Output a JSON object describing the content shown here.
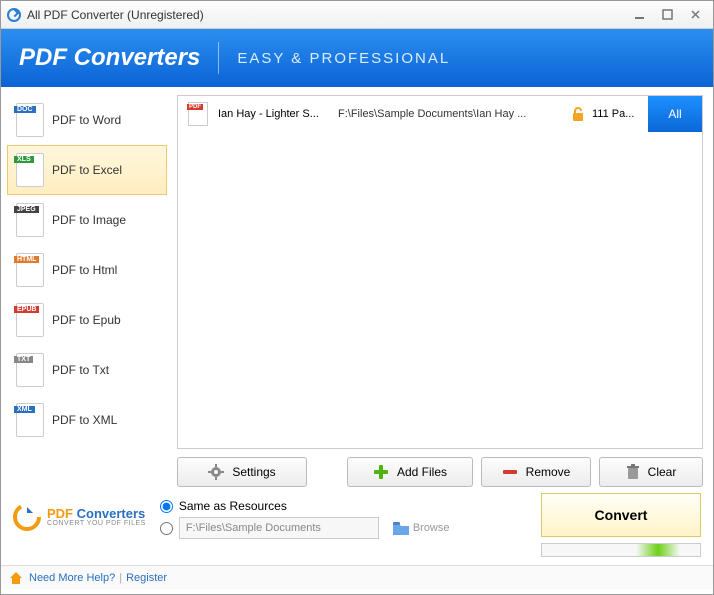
{
  "window": {
    "title": "All PDF Converter (Unregistered)"
  },
  "banner": {
    "title": "PDF Converters",
    "tagline": "EASY & PROFESSIONAL"
  },
  "sidebar": {
    "items": [
      {
        "label": "PDF to Word",
        "tag": "DOC",
        "tag_color": "#2a6fc0",
        "selected": false
      },
      {
        "label": "PDF to Excel",
        "tag": "XLS",
        "tag_color": "#2e9a3a",
        "selected": true
      },
      {
        "label": "PDF to Image",
        "tag": "JPEG",
        "tag_color": "#444444",
        "selected": false
      },
      {
        "label": "PDF to Html",
        "tag": "HTML",
        "tag_color": "#e07a2e",
        "selected": false
      },
      {
        "label": "PDF to Epub",
        "tag": "EPUB",
        "tag_color": "#d43b2e",
        "selected": false
      },
      {
        "label": "PDF to Txt",
        "tag": "TXT",
        "tag_color": "#888888",
        "selected": false
      },
      {
        "label": "PDF to XML",
        "tag": "XML",
        "tag_color": "#2a6fc0",
        "selected": false
      }
    ]
  },
  "files": [
    {
      "name": "Ian Hay - Lighter S...",
      "path": "F:\\Files\\Sample Documents\\Ian Hay ...",
      "pages": "111 Pa...",
      "range": "All"
    }
  ],
  "toolbar": {
    "settings": "Settings",
    "add": "Add Files",
    "remove": "Remove",
    "clear": "Clear"
  },
  "output": {
    "same_label": "Same as Resources",
    "path_value": "F:\\Files\\Sample Documents",
    "browse": "Browse",
    "selected": "same"
  },
  "brand": {
    "name_pdf": "PDF",
    "name_rest": " Converters",
    "subtitle": "CONVERT YOU PDF FILES"
  },
  "convert_label": "Convert",
  "status": {
    "help": "Need More Help?",
    "register": "Register"
  }
}
